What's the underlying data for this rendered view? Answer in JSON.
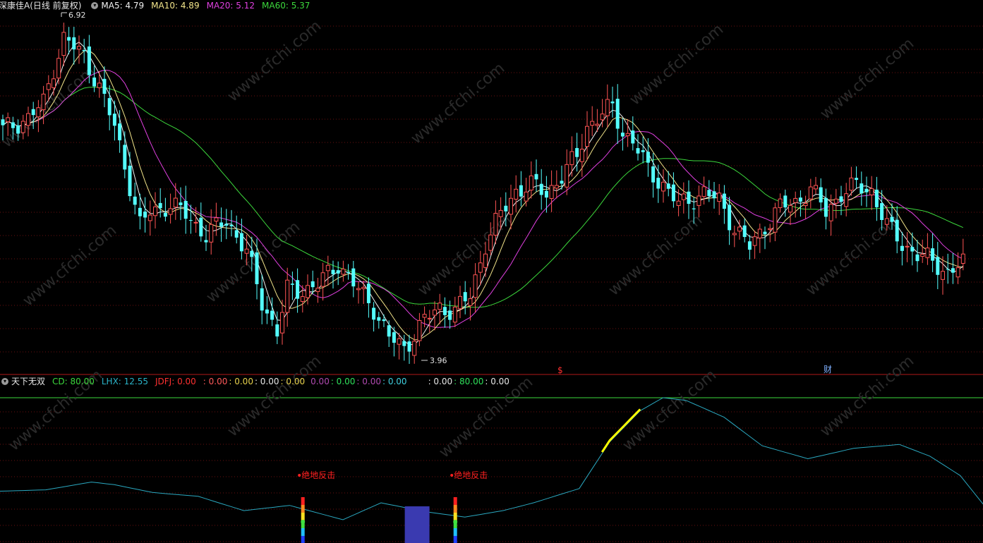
{
  "header": {
    "stock_title": "深康佳A(日线 前复权)",
    "ma5_label": "MA5: 4.79",
    "ma10_label": "MA10: 4.89",
    "ma20_label": "MA20: 5.12",
    "ma60_label": "MA60: 5.37"
  },
  "indicator_header": {
    "name": "天下无双",
    "cd_label": "CD: 80.00",
    "lhx_label": "LHX: 12.55",
    "jdfj_label": "JDFJ: 0.00",
    "v1": ": 0.00",
    "v2": ": 0.00",
    "v3": ": 0.00",
    "v4": ": 0.00",
    "v5": "0.00",
    "v6": ": 0.00",
    "v7": ": 0.00",
    "v8": ": 0.00",
    "v9": ": 0.00",
    "v10": ": 80.00",
    "v11": ": 0.00"
  },
  "price_annotations": {
    "high": "6.92",
    "low": "3.96"
  },
  "event_markers": {
    "dollar": "$",
    "cai": "财"
  },
  "signals": {
    "label": "绝地反击"
  },
  "colors": {
    "up": "#ff5454",
    "down": "#54ffff",
    "ma5": "#f0f0f0",
    "ma10": "#f2e48a",
    "ma20": "#e040e0",
    "ma60": "#3cd83c",
    "grid": "#6a1010",
    "lhx": "#2aa8c0",
    "cd": "#3cd83c",
    "separator": "#b01818",
    "signal": "#ff2020",
    "block": "#3a3ab0"
  },
  "chart_data": [
    {
      "type": "candlestick",
      "title": "深康佳A(日线 前复权)",
      "count": 190,
      "ylim": [
        3.96,
        6.92
      ],
      "grid": true,
      "anchors": [
        [
          0,
          5.92
        ],
        [
          5,
          6.02
        ],
        [
          8,
          6.15
        ],
        [
          10,
          6.45
        ],
        [
          12,
          6.7
        ],
        [
          16,
          6.55
        ],
        [
          19,
          6.28
        ],
        [
          22,
          5.95
        ],
        [
          25,
          5.45
        ],
        [
          27,
          5.1
        ],
        [
          29,
          5.22
        ],
        [
          33,
          5.28
        ],
        [
          36,
          5.2
        ],
        [
          40,
          5.02
        ],
        [
          44,
          5.15
        ],
        [
          48,
          4.88
        ],
        [
          51,
          4.45
        ],
        [
          54,
          4.2
        ],
        [
          56,
          4.55
        ],
        [
          59,
          4.55
        ],
        [
          62,
          4.6
        ],
        [
          66,
          4.78
        ],
        [
          70,
          4.55
        ],
        [
          73,
          4.4
        ],
        [
          76,
          4.15
        ],
        [
          79,
          4.05
        ],
        [
          81,
          4.18
        ],
        [
          83,
          4.3
        ],
        [
          86,
          4.4
        ],
        [
          89,
          4.38
        ],
        [
          92,
          4.5
        ],
        [
          95,
          4.95
        ],
        [
          98,
          5.2
        ],
        [
          101,
          5.4
        ],
        [
          104,
          5.45
        ],
        [
          107,
          5.38
        ],
        [
          110,
          5.52
        ],
        [
          113,
          5.7
        ],
        [
          115,
          5.95
        ],
        [
          118,
          6.05
        ],
        [
          120,
          6.12
        ],
        [
          122,
          5.9
        ],
        [
          124,
          5.82
        ],
        [
          127,
          5.58
        ],
        [
          130,
          5.45
        ],
        [
          133,
          5.28
        ],
        [
          135,
          5.32
        ],
        [
          138,
          5.38
        ],
        [
          141,
          5.32
        ],
        [
          144,
          5.08
        ],
        [
          147,
          4.92
        ],
        [
          150,
          5.1
        ],
        [
          153,
          5.26
        ],
        [
          156,
          5.3
        ],
        [
          159,
          5.42
        ],
        [
          162,
          5.22
        ],
        [
          165,
          5.38
        ],
        [
          168,
          5.44
        ],
        [
          171,
          5.4
        ],
        [
          174,
          5.1
        ],
        [
          177,
          4.95
        ],
        [
          180,
          4.85
        ],
        [
          183,
          4.8
        ],
        [
          186,
          4.7
        ],
        [
          189,
          4.78
        ]
      ]
    },
    {
      "type": "line",
      "title": "天下无双",
      "series": [
        {
          "name": "CD",
          "values": [
            80.0
          ]
        },
        {
          "name": "LHX",
          "values": [
            12.55
          ]
        },
        {
          "name": "JDFJ",
          "values": [
            0.0
          ]
        }
      ],
      "lhx_anchors": [
        [
          0,
          28
        ],
        [
          6,
          29
        ],
        [
          12,
          35
        ],
        [
          15,
          33
        ],
        [
          20,
          27
        ],
        [
          26,
          24
        ],
        [
          32,
          13
        ],
        [
          38,
          17
        ],
        [
          45,
          6
        ],
        [
          50,
          19
        ],
        [
          56,
          12
        ],
        [
          61,
          8
        ],
        [
          66,
          13
        ],
        [
          70,
          19
        ],
        [
          76,
          30
        ],
        [
          80,
          66
        ],
        [
          84,
          90
        ],
        [
          87,
          100
        ],
        [
          90,
          98
        ],
        [
          95,
          85
        ],
        [
          100,
          63
        ],
        [
          106,
          53
        ],
        [
          112,
          61
        ],
        [
          118,
          64
        ],
        [
          122,
          55
        ],
        [
          126,
          40
        ],
        [
          129,
          18
        ]
      ],
      "signal_indices": [
        39,
        59
      ],
      "block_range": [
        52,
        55
      ],
      "hump_range": [
        79,
        84
      ]
    }
  ]
}
